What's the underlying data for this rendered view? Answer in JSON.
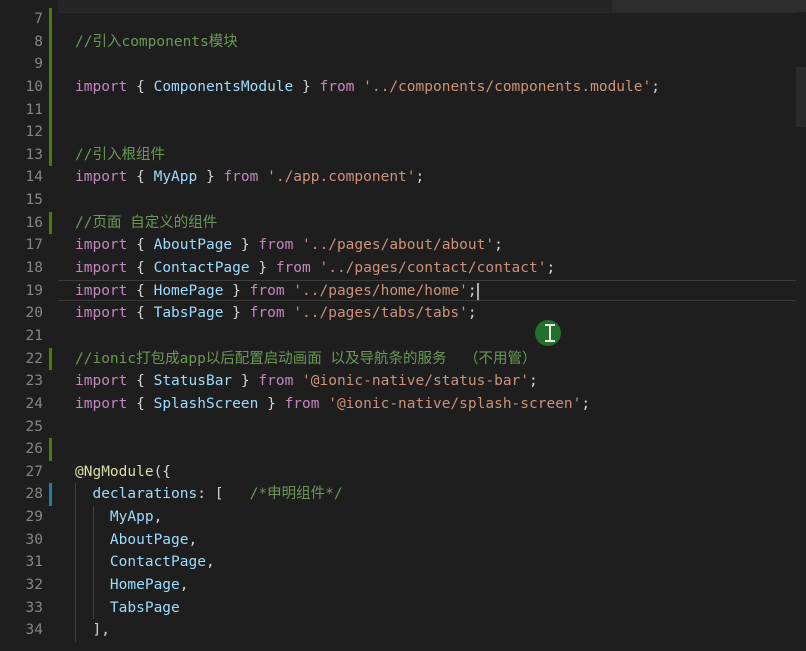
{
  "editor": {
    "colors": {
      "background": "#1e1e1e",
      "line_number": "#858585",
      "comment": "#6a9955",
      "keyword": "#c586c0",
      "identifier": "#9cdcfe",
      "string": "#ce9178",
      "decorator": "#dcdcaa",
      "punctuation": "#d4d4d4",
      "gutter_added": "#487e02",
      "gutter_modified": "#1b81a8"
    },
    "current_line": "19",
    "lines": [
      {
        "num": "7",
        "mod": "green",
        "tokens": []
      },
      {
        "num": "8",
        "mod": "green",
        "tokens": [
          {
            "t": "//引入components模块",
            "c": "cmt"
          }
        ]
      },
      {
        "num": "9",
        "mod": "green",
        "tokens": []
      },
      {
        "num": "10",
        "mod": "green",
        "tokens": [
          {
            "t": "import",
            "c": "kw"
          },
          {
            "t": " { ",
            "c": "pun"
          },
          {
            "t": "ComponentsModule",
            "c": "id"
          },
          {
            "t": " } ",
            "c": "pun"
          },
          {
            "t": "from",
            "c": "kw"
          },
          {
            "t": " ",
            "c": "pun"
          },
          {
            "t": "'../components/components.module'",
            "c": "str"
          },
          {
            "t": ";",
            "c": "pun"
          }
        ]
      },
      {
        "num": "11",
        "mod": "green",
        "tokens": []
      },
      {
        "num": "12",
        "mod": "green",
        "tokens": []
      },
      {
        "num": "13",
        "mod": "green",
        "tokens": [
          {
            "t": "//引入根组件",
            "c": "cmt"
          }
        ]
      },
      {
        "num": "14",
        "mod": "",
        "tokens": [
          {
            "t": "import",
            "c": "kw"
          },
          {
            "t": " { ",
            "c": "pun"
          },
          {
            "t": "MyApp",
            "c": "id"
          },
          {
            "t": " } ",
            "c": "pun"
          },
          {
            "t": "from",
            "c": "kw"
          },
          {
            "t": " ",
            "c": "pun"
          },
          {
            "t": "'./app.component'",
            "c": "str"
          },
          {
            "t": ";",
            "c": "pun"
          }
        ]
      },
      {
        "num": "15",
        "mod": "",
        "tokens": []
      },
      {
        "num": "16",
        "mod": "green",
        "tokens": [
          {
            "t": "//页面 自定义的组件",
            "c": "cmt"
          }
        ]
      },
      {
        "num": "17",
        "mod": "",
        "tokens": [
          {
            "t": "import",
            "c": "kw"
          },
          {
            "t": " { ",
            "c": "pun"
          },
          {
            "t": "AboutPage",
            "c": "id"
          },
          {
            "t": " } ",
            "c": "pun"
          },
          {
            "t": "from",
            "c": "kw"
          },
          {
            "t": " ",
            "c": "pun"
          },
          {
            "t": "'../pages/about/about'",
            "c": "str"
          },
          {
            "t": ";",
            "c": "pun"
          }
        ]
      },
      {
        "num": "18",
        "mod": "",
        "tokens": [
          {
            "t": "import",
            "c": "kw"
          },
          {
            "t": " { ",
            "c": "pun"
          },
          {
            "t": "ContactPage",
            "c": "id"
          },
          {
            "t": " } ",
            "c": "pun"
          },
          {
            "t": "from",
            "c": "kw"
          },
          {
            "t": " ",
            "c": "pun"
          },
          {
            "t": "'../pages/contact/contact'",
            "c": "str"
          },
          {
            "t": ";",
            "c": "pun"
          }
        ]
      },
      {
        "num": "19",
        "mod": "",
        "tokens": [
          {
            "t": "import",
            "c": "kw"
          },
          {
            "t": " { ",
            "c": "pun"
          },
          {
            "t": "HomePage",
            "c": "id"
          },
          {
            "t": " } ",
            "c": "pun"
          },
          {
            "t": "from",
            "c": "kw"
          },
          {
            "t": " ",
            "c": "pun"
          },
          {
            "t": "'../pages/home/home'",
            "c": "str"
          },
          {
            "t": ";",
            "c": "pun"
          }
        ]
      },
      {
        "num": "20",
        "mod": "",
        "tokens": [
          {
            "t": "import",
            "c": "kw"
          },
          {
            "t": " { ",
            "c": "pun"
          },
          {
            "t": "TabsPage",
            "c": "id"
          },
          {
            "t": " } ",
            "c": "pun"
          },
          {
            "t": "from",
            "c": "kw"
          },
          {
            "t": " ",
            "c": "pun"
          },
          {
            "t": "'../pages/tabs/tabs'",
            "c": "str"
          },
          {
            "t": ";",
            "c": "pun"
          }
        ]
      },
      {
        "num": "21",
        "mod": "",
        "tokens": []
      },
      {
        "num": "22",
        "mod": "green",
        "tokens": [
          {
            "t": "//ionic打包成app以后配置启动画面 以及导航条的服务  （不用管）",
            "c": "cmt"
          }
        ]
      },
      {
        "num": "23",
        "mod": "",
        "tokens": [
          {
            "t": "import",
            "c": "kw"
          },
          {
            "t": " { ",
            "c": "pun"
          },
          {
            "t": "StatusBar",
            "c": "id"
          },
          {
            "t": " } ",
            "c": "pun"
          },
          {
            "t": "from",
            "c": "kw"
          },
          {
            "t": " ",
            "c": "pun"
          },
          {
            "t": "'@ionic-native/status-bar'",
            "c": "str"
          },
          {
            "t": ";",
            "c": "pun"
          }
        ]
      },
      {
        "num": "24",
        "mod": "",
        "tokens": [
          {
            "t": "import",
            "c": "kw"
          },
          {
            "t": " { ",
            "c": "pun"
          },
          {
            "t": "SplashScreen",
            "c": "id"
          },
          {
            "t": " } ",
            "c": "pun"
          },
          {
            "t": "from",
            "c": "kw"
          },
          {
            "t": " ",
            "c": "pun"
          },
          {
            "t": "'@ionic-native/splash-screen'",
            "c": "str"
          },
          {
            "t": ";",
            "c": "pun"
          }
        ]
      },
      {
        "num": "25",
        "mod": "",
        "tokens": []
      },
      {
        "num": "26",
        "mod": "green",
        "tokens": []
      },
      {
        "num": "27",
        "mod": "",
        "tokens": [
          {
            "t": "@NgModule",
            "c": "dec"
          },
          {
            "t": "({",
            "c": "pun"
          }
        ]
      },
      {
        "num": "28",
        "mod": "blue",
        "indent": 1,
        "tokens": [
          {
            "t": "  ",
            "c": "pun"
          },
          {
            "t": "declarations",
            "c": "id"
          },
          {
            "t": ": [   ",
            "c": "pun"
          },
          {
            "t": "/*申明组件*/",
            "c": "cmt"
          }
        ]
      },
      {
        "num": "29",
        "mod": "",
        "indent": 2,
        "tokens": [
          {
            "t": "    ",
            "c": "pun"
          },
          {
            "t": "MyApp",
            "c": "id"
          },
          {
            "t": ",",
            "c": "pun"
          }
        ]
      },
      {
        "num": "30",
        "mod": "",
        "indent": 2,
        "tokens": [
          {
            "t": "    ",
            "c": "pun"
          },
          {
            "t": "AboutPage",
            "c": "id"
          },
          {
            "t": ",",
            "c": "pun"
          }
        ]
      },
      {
        "num": "31",
        "mod": "",
        "indent": 2,
        "tokens": [
          {
            "t": "    ",
            "c": "pun"
          },
          {
            "t": "ContactPage",
            "c": "id"
          },
          {
            "t": ",",
            "c": "pun"
          }
        ]
      },
      {
        "num": "32",
        "mod": "",
        "indent": 2,
        "tokens": [
          {
            "t": "    ",
            "c": "pun"
          },
          {
            "t": "HomePage",
            "c": "id"
          },
          {
            "t": ",",
            "c": "pun"
          }
        ]
      },
      {
        "num": "33",
        "mod": "",
        "indent": 2,
        "tokens": [
          {
            "t": "    ",
            "c": "pun"
          },
          {
            "t": "TabsPage",
            "c": "id"
          }
        ]
      },
      {
        "num": "34",
        "mod": "",
        "indent": 1,
        "tokens": [
          {
            "t": "  ",
            "c": "pun"
          },
          {
            "t": "],",
            "c": "pun"
          }
        ]
      }
    ]
  }
}
